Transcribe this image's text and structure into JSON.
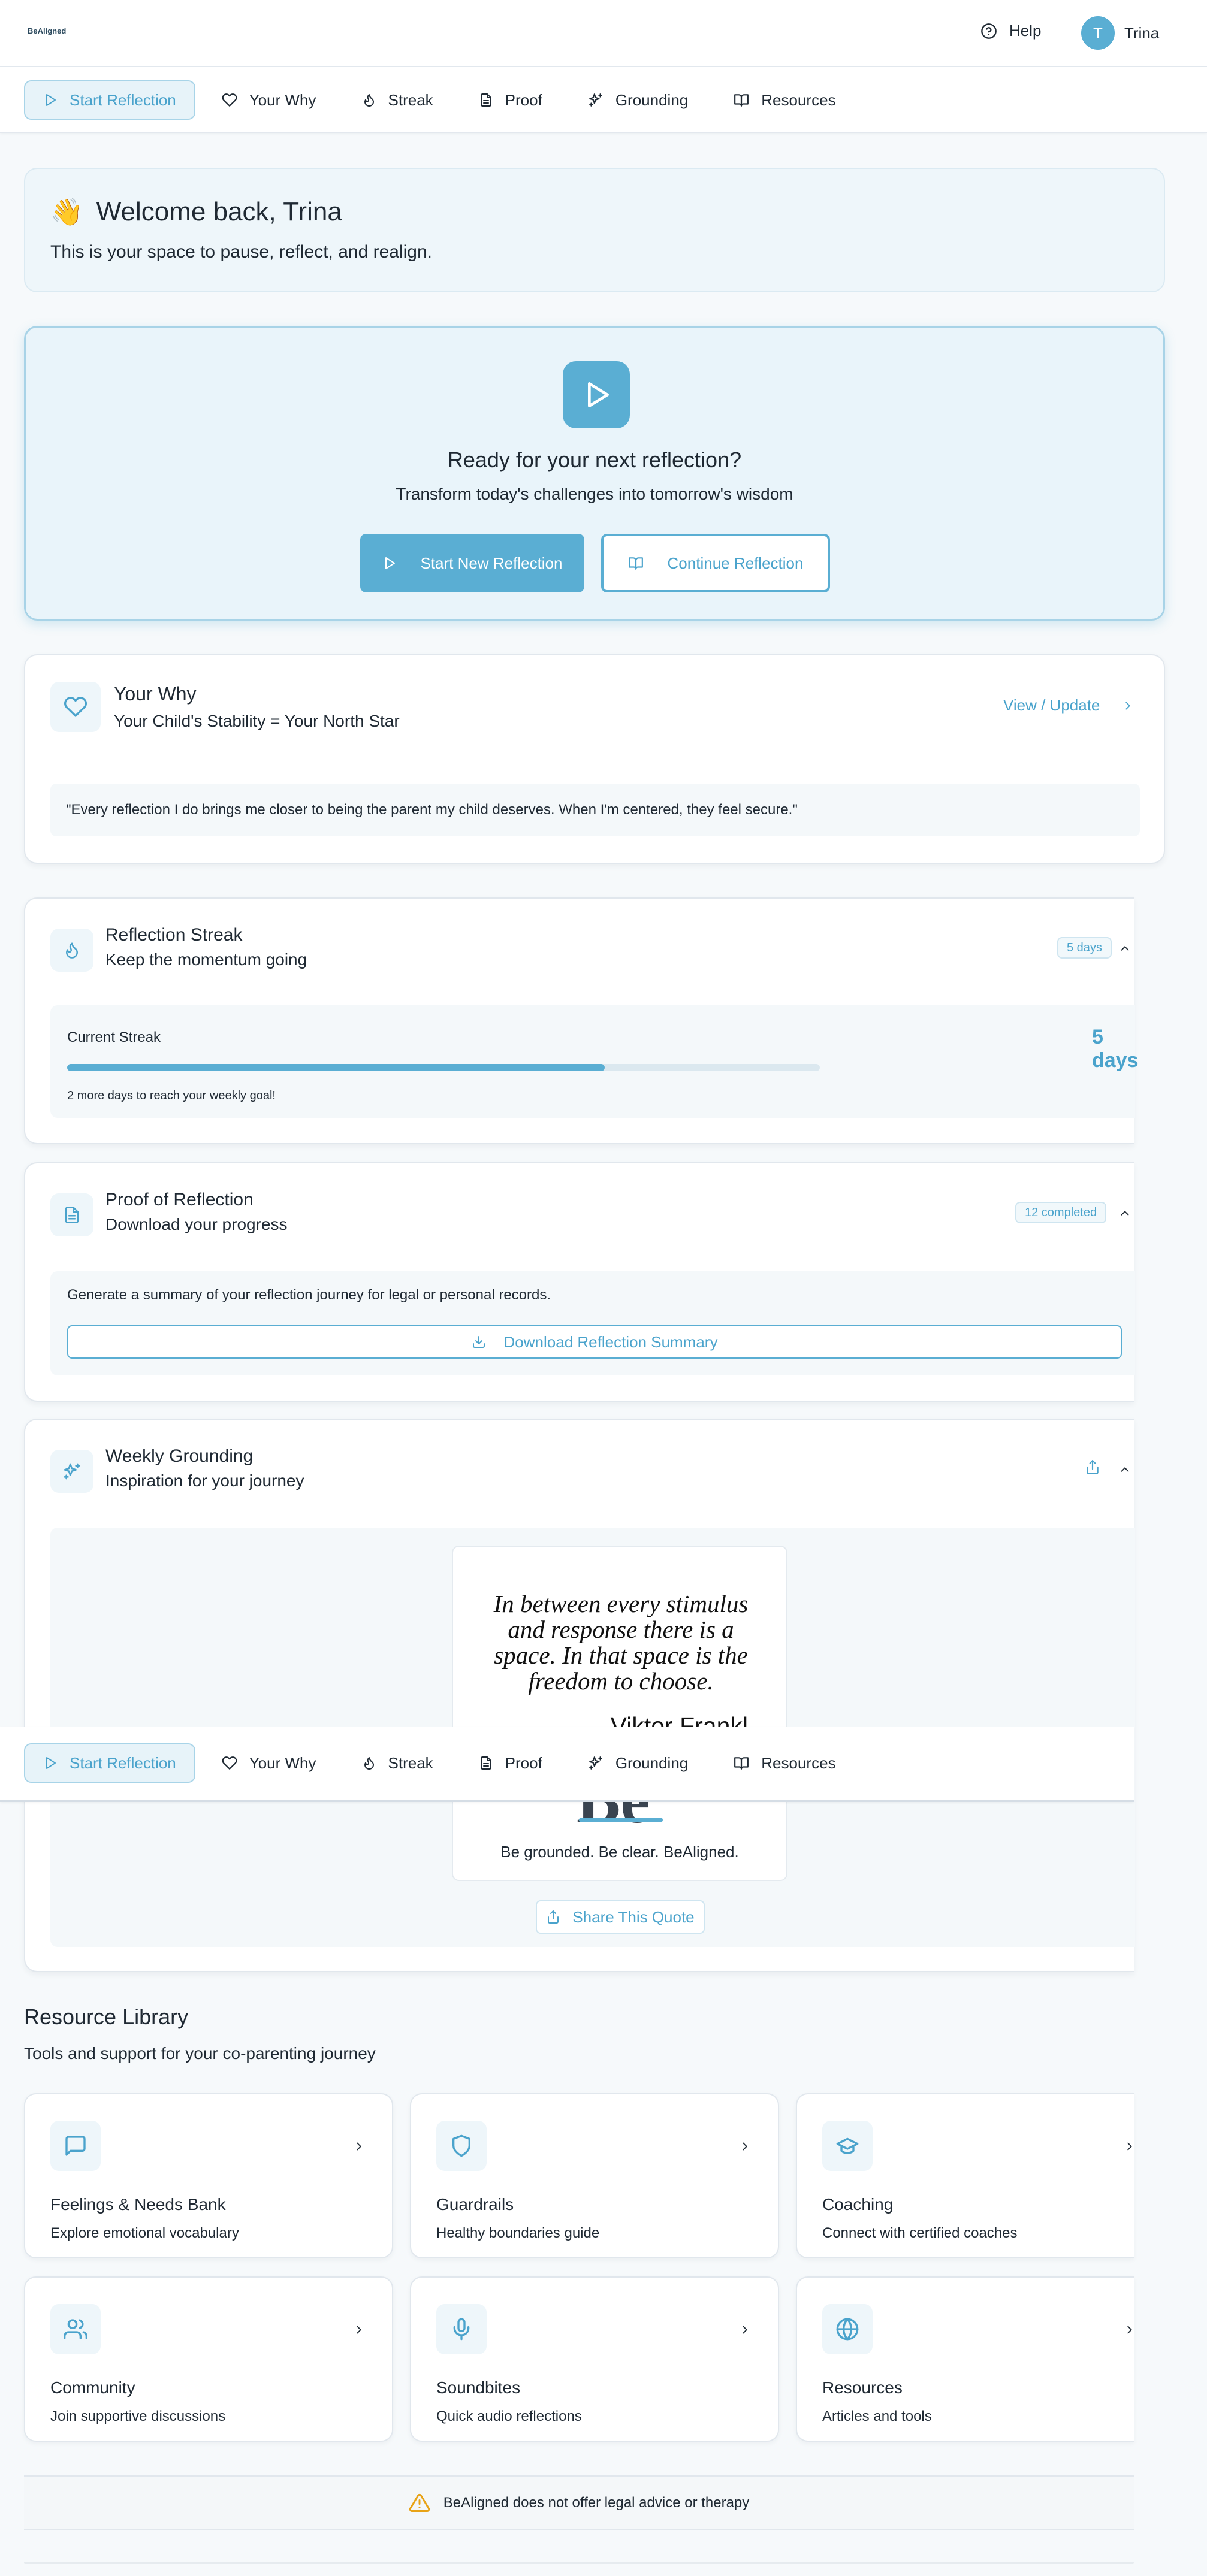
{
  "header": {
    "logo_brand": "BeAligned",
    "help_label": "Help",
    "avatar_initial": "T",
    "user_name": "Trina"
  },
  "nav": {
    "tabs": [
      {
        "label": "Start Reflection",
        "icon": "play-icon",
        "active": true
      },
      {
        "label": "Your Why",
        "icon": "heart-icon"
      },
      {
        "label": "Streak",
        "icon": "flame-icon"
      },
      {
        "label": "Proof",
        "icon": "file-icon"
      },
      {
        "label": "Grounding",
        "icon": "sparkles-icon"
      },
      {
        "label": "Resources",
        "icon": "book-open-icon"
      }
    ]
  },
  "welcome": {
    "emoji": "👋",
    "title": "Welcome back, Trina",
    "subtitle": "This is your space to pause, reflect, and realign."
  },
  "cta": {
    "title": "Ready for your next reflection?",
    "subtitle": "Transform today's challenges into tomorrow's wisdom",
    "primary_label": "Start New Reflection",
    "secondary_label": "Continue Reflection"
  },
  "your_why": {
    "title": "Your Why",
    "subtitle": "Your Child's Stability = Your North Star",
    "link_label": "View / Update",
    "quote": "\"Every reflection I do brings me closer to being the parent my child deserves. When I'm centered, they feel secure.\""
  },
  "streak": {
    "title": "Reflection Streak",
    "subtitle": "Keep the momentum going",
    "badge": "5 days",
    "current_label": "Current Streak",
    "current_value": "5 days",
    "progress_fraction": 0.714,
    "hint": "2 more days to reach your weekly goal!"
  },
  "proof": {
    "title": "Proof of Reflection",
    "subtitle": "Download your progress",
    "badge": "12 completed",
    "description": "Generate a summary of your reflection journey for legal or personal records.",
    "download_label": "Download Reflection Summary"
  },
  "grounding": {
    "title": "Weekly Grounding",
    "subtitle": "Inspiration for your journey",
    "quote": "In between every stimulus and response there is a space. In that space is the freedom to choose.",
    "author": "— Viktor Frankl",
    "brand_mark": "Be",
    "tagline": "Be grounded. Be clear. BeAligned.",
    "share_label": "Share This Quote"
  },
  "library": {
    "title": "Resource Library",
    "subtitle": "Tools and support for your co-parenting journey",
    "items": [
      {
        "title": "Feelings & Needs Bank",
        "subtitle": "Explore emotional vocabulary",
        "icon": "message-square-icon"
      },
      {
        "title": "Guardrails",
        "subtitle": "Healthy boundaries guide",
        "icon": "shield-icon"
      },
      {
        "title": "Coaching",
        "subtitle": "Connect with certified coaches",
        "icon": "graduation-cap-icon"
      },
      {
        "title": "Community",
        "subtitle": "Join supportive discussions",
        "icon": "users-icon"
      },
      {
        "title": "Soundbites",
        "subtitle": "Quick audio reflections",
        "icon": "mic-icon"
      },
      {
        "title": "Resources",
        "subtitle": "Articles and tools",
        "icon": "globe-icon"
      }
    ]
  },
  "disclaimer": "BeAligned does not offer legal advice or therapy",
  "colors": {
    "accent": "#5aaed3",
    "accent_text": "#4aa3cc",
    "soft_bg": "#eef6fa",
    "warning": "#e8a317"
  }
}
